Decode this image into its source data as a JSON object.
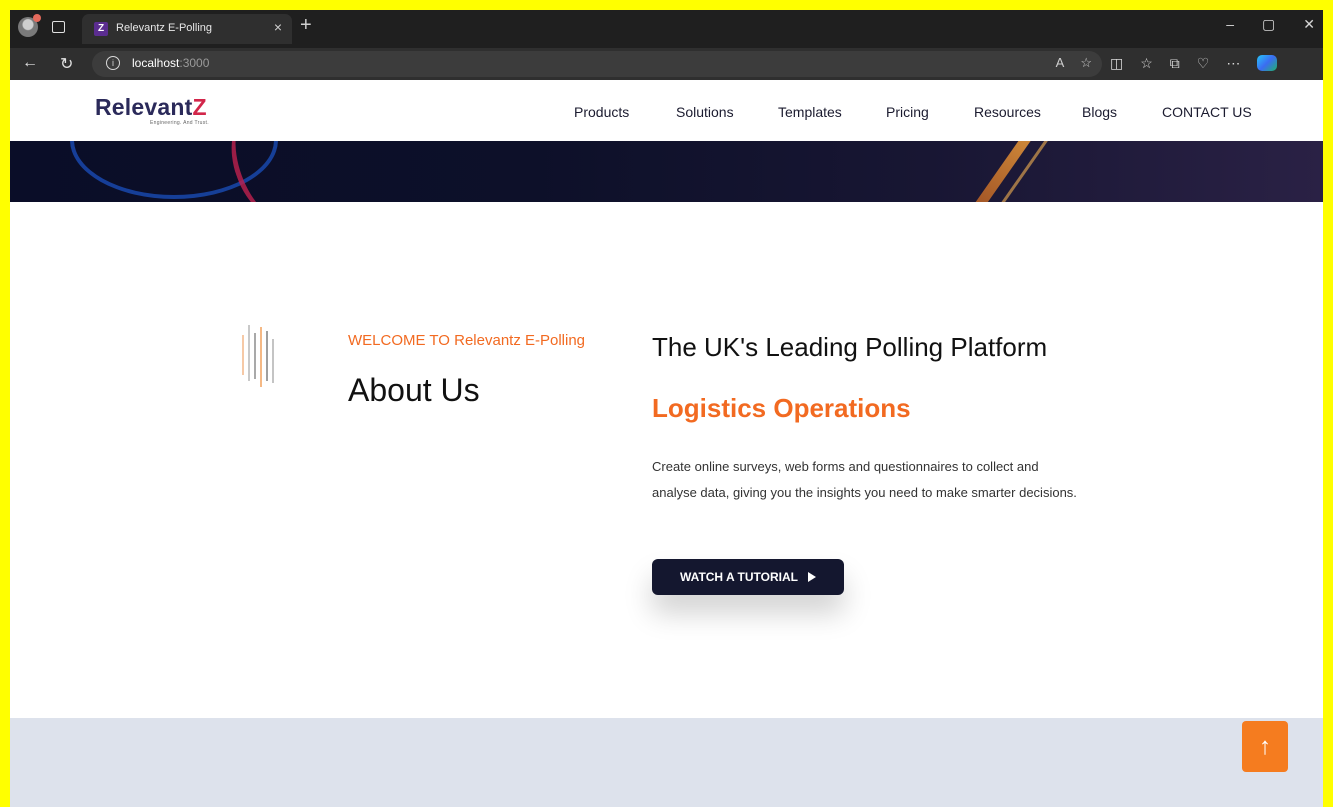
{
  "browser": {
    "tab_title": "Relevantz E-Polling",
    "tab_close": "×",
    "new_tab": "+",
    "url_host": "localhost",
    "url_port": ":3000",
    "minimize": "–",
    "restore": "▢",
    "close": "✕"
  },
  "site": {
    "logo_text": "Relevant",
    "logo_mark": "Z",
    "logo_tagline": "Engineering. And Trust.",
    "nav": [
      "Products",
      "Solutions",
      "Templates",
      "Pricing",
      "Resources",
      "Blogs",
      "CONTACT US"
    ]
  },
  "about": {
    "welcome": "WELCOME TO Relevantz E-Polling",
    "heading": "About Us",
    "platform_title": "The UK's Leading Polling Platform",
    "sector": "Logistics Operations",
    "description": "Create online surveys, web forms and questionnaires to collect and analyse data, giving you the insights you need to make smarter decisions.",
    "cta_label": "WATCH A TUTORIAL"
  },
  "scroll_top_icon": "↑",
  "colors": {
    "accent": "#f26a21",
    "dark": "#14172f",
    "frame": "#ffff00"
  }
}
